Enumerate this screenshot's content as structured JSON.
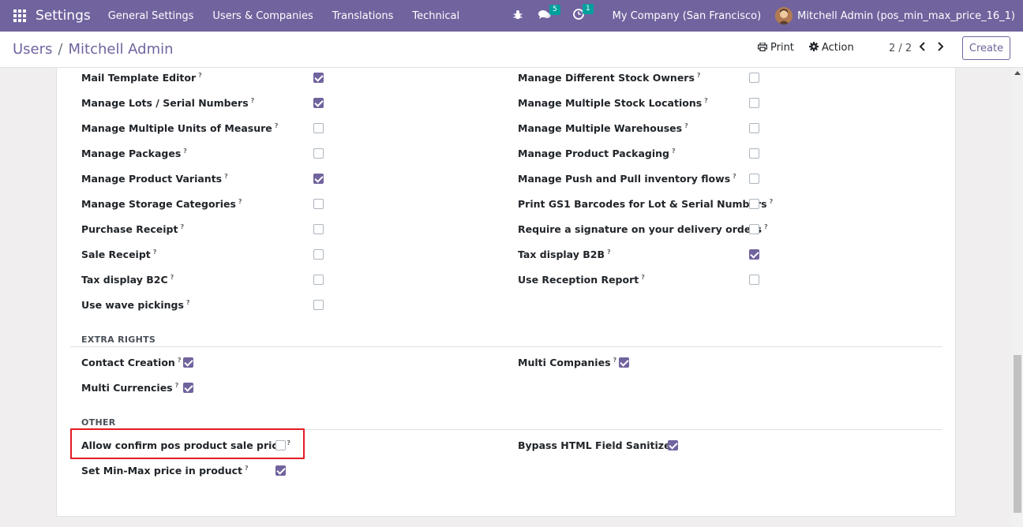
{
  "navbar": {
    "brand": "Settings",
    "menu": [
      "General Settings",
      "Users & Companies",
      "Translations",
      "Technical"
    ],
    "chat_badge": "5",
    "activity_badge": "1",
    "company": "My Company (San Francisco)",
    "user": "Mitchell Admin (pos_min_max_price_16_1)"
  },
  "breadcrumb": {
    "parent": "Users",
    "separator": "/",
    "current": "Mitchell Admin"
  },
  "toolbar": {
    "print": "Print",
    "action": "Action",
    "pager": "2 / 2",
    "create": "Create"
  },
  "rights_left": [
    {
      "label": "Mail Template Editor",
      "checked": true
    },
    {
      "label": "Manage Lots / Serial Numbers",
      "checked": true
    },
    {
      "label": "Manage Multiple Units of Measure",
      "checked": false
    },
    {
      "label": "Manage Packages",
      "checked": false
    },
    {
      "label": "Manage Product Variants",
      "checked": true
    },
    {
      "label": "Manage Storage Categories",
      "checked": false
    },
    {
      "label": "Purchase Receipt",
      "checked": false
    },
    {
      "label": "Sale Receipt",
      "checked": false
    },
    {
      "label": "Tax display B2C",
      "checked": false
    },
    {
      "label": "Use wave pickings",
      "checked": false
    }
  ],
  "rights_right": [
    {
      "label": "Manage Different Stock Owners",
      "checked": false
    },
    {
      "label": "Manage Multiple Stock Locations",
      "checked": false
    },
    {
      "label": "Manage Multiple Warehouses",
      "checked": false
    },
    {
      "label": "Manage Product Packaging",
      "checked": false
    },
    {
      "label": "Manage Push and Pull inventory flows",
      "checked": false
    },
    {
      "label": "Print GS1 Barcodes for Lot & Serial Numbers",
      "checked": false
    },
    {
      "label": "Require a signature on your delivery orders",
      "checked": false
    },
    {
      "label": "Tax display B2B",
      "checked": true
    },
    {
      "label": "Use Reception Report",
      "checked": false
    }
  ],
  "extra_rights": {
    "title": "EXTRA RIGHTS",
    "left": [
      {
        "label": "Contact Creation",
        "checked": true
      },
      {
        "label": "Multi Currencies",
        "checked": true
      }
    ],
    "right": [
      {
        "label": "Multi Companies",
        "checked": true
      }
    ]
  },
  "other": {
    "title": "OTHER",
    "left": [
      {
        "label": "Allow confirm pos product sale price",
        "checked": false
      },
      {
        "label": "Set Min-Max price in product",
        "checked": true
      }
    ],
    "right": [
      {
        "label": "Bypass HTML Field Sanitize",
        "checked": true
      }
    ]
  },
  "help_marker": "?"
}
